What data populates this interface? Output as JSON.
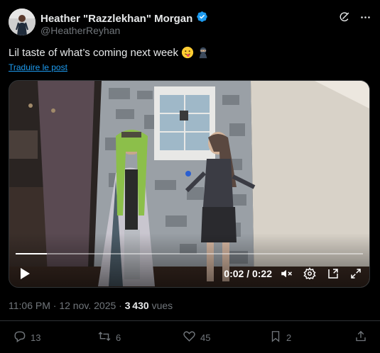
{
  "author": {
    "display_name": "Heather \"Razzlekhan\" Morgan",
    "handle": "@HeatherReyhan",
    "verified_icon": "verified-badge-icon",
    "badge_color": "#1d9bf0"
  },
  "header_icons": [
    "grok-icon",
    "more-icon"
  ],
  "tweet": {
    "text": "Lil taste of what’s coming next week",
    "emojis": [
      "drooling-tongue-face-emoji",
      "ninja-emoji"
    ],
    "translate_label": "Traduire le post"
  },
  "video": {
    "progress": 0.09,
    "timecode": "0:02 / 0:22",
    "controls": [
      "play-icon",
      "mute-icon",
      "settings-icon",
      "pip-icon",
      "fullscreen-icon"
    ]
  },
  "meta": {
    "time": "11:06 PM",
    "sep": "·",
    "date": "12 nov. 2025",
    "views_count": "3 430",
    "views_label": "vues"
  },
  "actions": {
    "replies": "13",
    "reposts": "6",
    "likes": "45",
    "bookmarks": "2"
  },
  "colors": {
    "accent": "#1d9bf0",
    "muted": "#71767b",
    "text": "#e7e9ea",
    "background": "#000000"
  }
}
